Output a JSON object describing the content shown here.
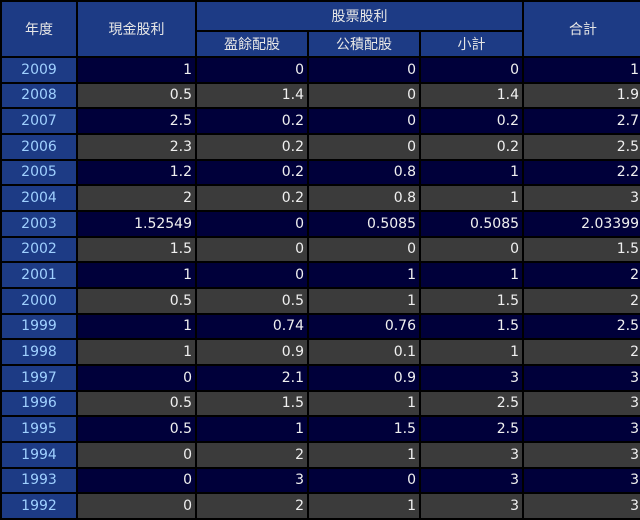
{
  "table": {
    "headers": {
      "year": "年度",
      "cash_dividend": "現金股利",
      "stock_dividend": "股票股利",
      "retained_earnings_stock": "盈餘配股",
      "capital_reserve_stock": "公積配股",
      "stock_subtotal": "小計",
      "total": "合計"
    },
    "rows": [
      {
        "year": "2009",
        "cash": "1",
        "retained": "0",
        "reserve": "0",
        "subtotal": "0",
        "total": "1"
      },
      {
        "year": "2008",
        "cash": "0.5",
        "retained": "1.4",
        "reserve": "0",
        "subtotal": "1.4",
        "total": "1.9"
      },
      {
        "year": "2007",
        "cash": "2.5",
        "retained": "0.2",
        "reserve": "0",
        "subtotal": "0.2",
        "total": "2.7"
      },
      {
        "year": "2006",
        "cash": "2.3",
        "retained": "0.2",
        "reserve": "0",
        "subtotal": "0.2",
        "total": "2.5"
      },
      {
        "year": "2005",
        "cash": "1.2",
        "retained": "0.2",
        "reserve": "0.8",
        "subtotal": "1",
        "total": "2.2"
      },
      {
        "year": "2004",
        "cash": "2",
        "retained": "0.2",
        "reserve": "0.8",
        "subtotal": "1",
        "total": "3"
      },
      {
        "year": "2003",
        "cash": "1.52549",
        "retained": "0",
        "reserve": "0.5085",
        "subtotal": "0.5085",
        "total": "2.03399"
      },
      {
        "year": "2002",
        "cash": "1.5",
        "retained": "0",
        "reserve": "0",
        "subtotal": "0",
        "total": "1.5"
      },
      {
        "year": "2001",
        "cash": "1",
        "retained": "0",
        "reserve": "1",
        "subtotal": "1",
        "total": "2"
      },
      {
        "year": "2000",
        "cash": "0.5",
        "retained": "0.5",
        "reserve": "1",
        "subtotal": "1.5",
        "total": "2"
      },
      {
        "year": "1999",
        "cash": "1",
        "retained": "0.74",
        "reserve": "0.76",
        "subtotal": "1.5",
        "total": "2.5"
      },
      {
        "year": "1998",
        "cash": "1",
        "retained": "0.9",
        "reserve": "0.1",
        "subtotal": "1",
        "total": "2"
      },
      {
        "year": "1997",
        "cash": "0",
        "retained": "2.1",
        "reserve": "0.9",
        "subtotal": "3",
        "total": "3"
      },
      {
        "year": "1996",
        "cash": "0.5",
        "retained": "1.5",
        "reserve": "1",
        "subtotal": "2.5",
        "total": "3"
      },
      {
        "year": "1995",
        "cash": "0.5",
        "retained": "1",
        "reserve": "1.5",
        "subtotal": "2.5",
        "total": "3"
      },
      {
        "year": "1994",
        "cash": "0",
        "retained": "2",
        "reserve": "1",
        "subtotal": "3",
        "total": "3"
      },
      {
        "year": "1993",
        "cash": "0",
        "retained": "3",
        "reserve": "0",
        "subtotal": "3",
        "total": "3"
      },
      {
        "year": "1992",
        "cash": "0",
        "retained": "2",
        "reserve": "1",
        "subtotal": "3",
        "total": "3"
      }
    ]
  },
  "colors": {
    "header_background": "#1d3b85",
    "year_text": "#9fd0ff",
    "row_odd_background": "#00003a",
    "row_even_background": "#3b3b3b",
    "value_text": "#f0f0f0"
  }
}
